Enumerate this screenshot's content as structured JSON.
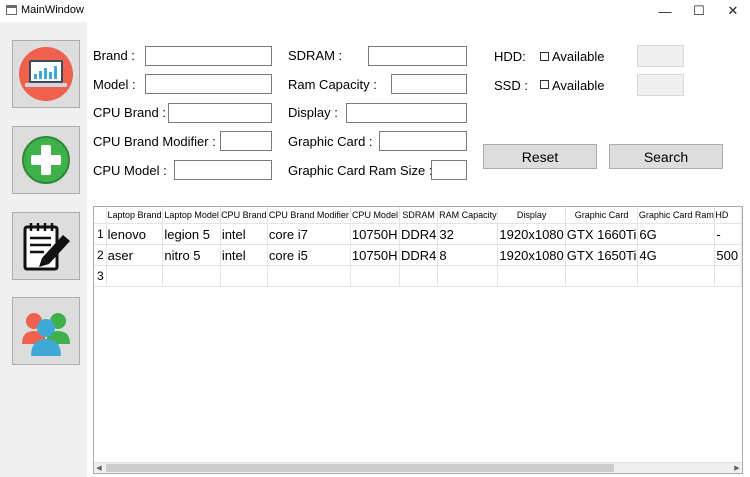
{
  "window": {
    "title": "MainWindow",
    "minimize_glyph": "—",
    "maximize_glyph": "☐",
    "close_glyph": "✕"
  },
  "sidebar": {
    "items": [
      {
        "icon": "laptop-icon"
      },
      {
        "icon": "add-icon"
      },
      {
        "icon": "notepad-edit-icon"
      },
      {
        "icon": "users-icon"
      }
    ]
  },
  "form": {
    "brand_label": "Brand :",
    "model_label": "Model :",
    "cpu_brand_label": "CPU Brand :",
    "cpu_brand_modifier_label": "CPU Brand Modifier :",
    "cpu_model_label": "CPU Model :",
    "sdram_label": "SDRAM :",
    "ram_capacity_label": "Ram Capacity :",
    "display_label": "Display :",
    "graphic_card_label": "Graphic Card :",
    "graphic_card_ram_label": "Graphic Card Ram Size :",
    "hdd_label": "HDD:",
    "ssd_label": "SSD :",
    "hdd_available_label": "Available",
    "ssd_available_label": "Available",
    "reset_label": "Reset",
    "search_label": "Search"
  },
  "table": {
    "columns": [
      "Laptop Brand",
      "Laptop Model",
      "CPU Brand",
      "CPU Brand Modifier",
      "CPU Model",
      "SDRAM",
      "RAM Capacity",
      "Display",
      "Graphic Card",
      "Graphic Card Ram",
      "HD"
    ],
    "rows": [
      {
        "num": "1",
        "cells": [
          "lenovo",
          "legion 5",
          "intel",
          "core i7",
          "10750H",
          "DDR4",
          "32",
          "1920x1080",
          "GTX 1660Ti",
          "6G",
          "-"
        ]
      },
      {
        "num": "2",
        "cells": [
          "aser",
          "nitro 5",
          "intel",
          "core i5",
          "10750H",
          "DDR4",
          "8",
          "1920x1080",
          "GTX 1650Ti",
          "4G",
          "500"
        ]
      },
      {
        "num": "3",
        "cells": [
          "",
          "",
          "",
          "",
          "",
          "",
          "",
          "",
          "",
          "",
          ""
        ]
      }
    ]
  }
}
